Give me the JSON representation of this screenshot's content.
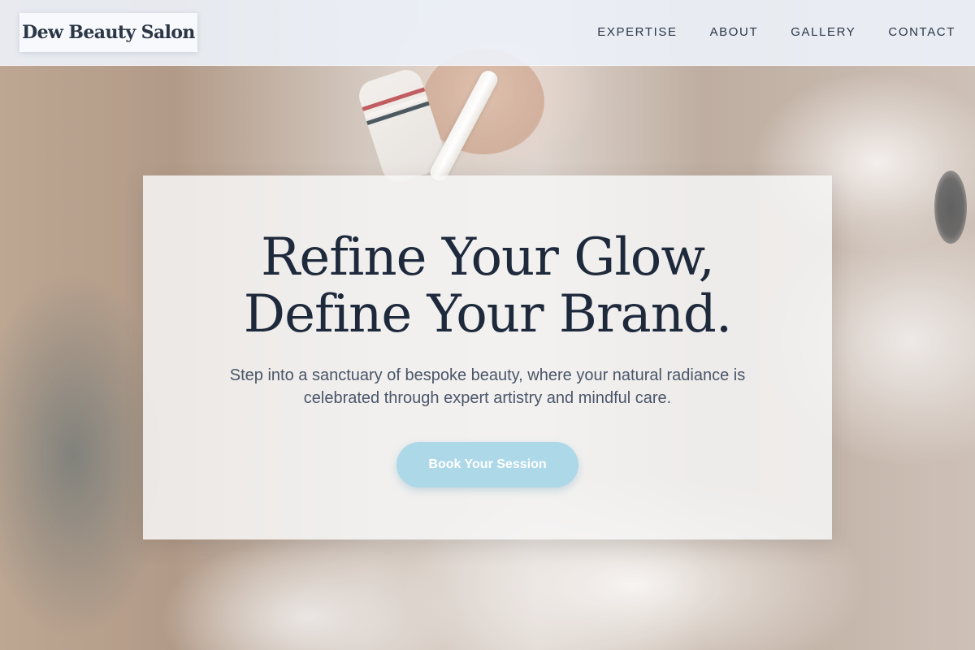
{
  "brand": {
    "name": "Dew Beauty Salon"
  },
  "nav": {
    "items": [
      {
        "label": "EXPERTISE"
      },
      {
        "label": "ABOUT"
      },
      {
        "label": "GALLERY"
      },
      {
        "label": "CONTACT"
      }
    ]
  },
  "hero": {
    "title_line1": "Refine Your Glow,",
    "title_line2": "Define Your Brand.",
    "subtitle": "Step into a sanctuary of bespoke beauty, where your natural radiance is celebrated through expert artistry and mindful care.",
    "cta_label": "Book Your Session"
  },
  "colors": {
    "nav_background": "#ecf2fa",
    "heading_text": "#1e2a3c",
    "body_text": "#4a5568",
    "cta_background": "#add8e8",
    "cta_text": "#ffffff"
  }
}
